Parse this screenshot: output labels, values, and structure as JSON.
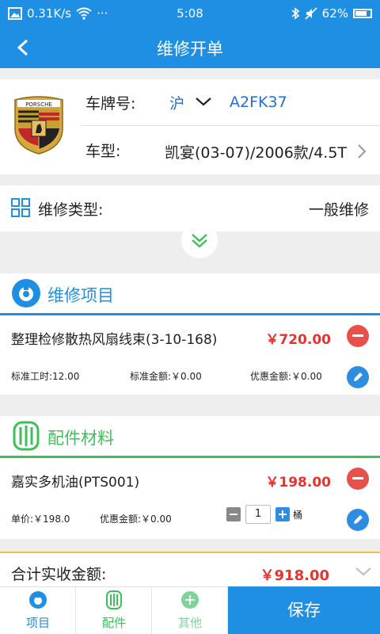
{
  "status": {
    "speed": "0.31K/s",
    "dots": "···",
    "time": "5:08",
    "battery": "62%"
  },
  "header": {
    "title": "维修开单"
  },
  "car": {
    "plate_label": "车牌号:",
    "plate_province": "沪",
    "plate_number": "A2FK37",
    "model_label": "车型:",
    "model_value": "凯宴(03-07)/2006款/4.5T",
    "logo_text": "PORSCHE"
  },
  "repair_type": {
    "label": "维修类型:",
    "value": "一般维修"
  },
  "repair_section": {
    "title": "维修项目",
    "items": [
      {
        "name": "整理检修散热风扇线束(3-10-168)",
        "price": "￥720.00",
        "std_hours": "标准工时:12.00",
        "std_amount": "标准金额:￥0.00",
        "discount": "优惠金额:￥0.00"
      }
    ]
  },
  "parts_section": {
    "title": "配件材料",
    "items": [
      {
        "name": "嘉实多机油(PTS001)",
        "price": "￥198.00",
        "unit_price": "单价:￥198.0",
        "discount": "优惠金额:￥0.00",
        "quantity": "1",
        "unit": "桶"
      }
    ]
  },
  "total": {
    "label": "合计实收金额:",
    "value": "￥918.00"
  },
  "nav": {
    "tabs": [
      {
        "label": "项目",
        "color": "#1f8fe3"
      },
      {
        "label": "配件",
        "color": "#3dbf5a"
      },
      {
        "label": "其他",
        "color": "#7ed49b"
      }
    ],
    "save_label": "保存"
  },
  "colors": {
    "primary": "#1f8fe3",
    "price": "#e5332e",
    "parts": "#3dbf5a",
    "total_border": "#f0c040"
  }
}
